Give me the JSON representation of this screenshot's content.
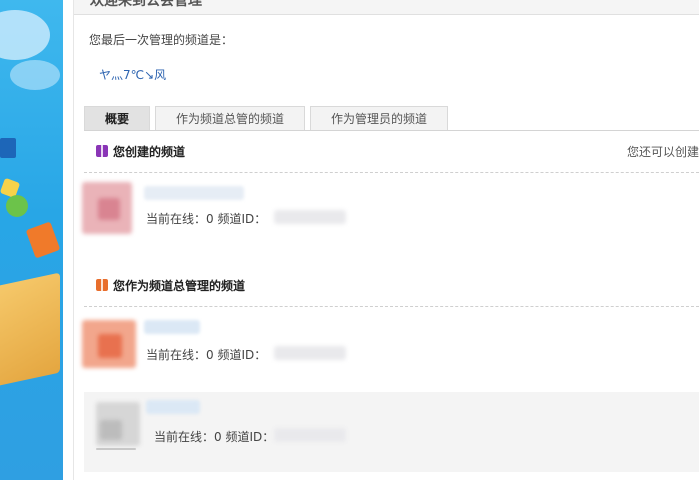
{
  "header": {
    "title": "欢迎来到公会管理"
  },
  "last_managed": {
    "label": "您最后一次管理的频道是：",
    "channel_name": "ヤ灬7℃↘风"
  },
  "tabs": [
    {
      "label": "概要",
      "active": true
    },
    {
      "label": "作为频道总管的频道",
      "active": false
    },
    {
      "label": "作为管理员的频道",
      "active": false
    }
  ],
  "created_section": {
    "title": "您创建的频道",
    "remaining_text": "您还可以创建",
    "channels": [
      {
        "online_text": "当前在线：0 频道ID：",
        "avatar_color": "#e6a3aa",
        "highlighted": false
      }
    ]
  },
  "owner_section": {
    "title": "您作为频道总管理的频道",
    "channels": [
      {
        "online_text": "当前在线：0 频道ID：",
        "avatar_color": "#ee8a6a",
        "highlighted": false
      },
      {
        "online_text": "当前在线：0 频道ID：",
        "avatar_color": "#bdbdbd",
        "highlighted": true
      }
    ]
  },
  "colors": {
    "link": "#2c63b0",
    "sidebar": "#2ea4e4",
    "created_icon": "#8a35b6",
    "owner_icon": "#e86e2c"
  },
  "icons": [
    "gift-icon"
  ]
}
